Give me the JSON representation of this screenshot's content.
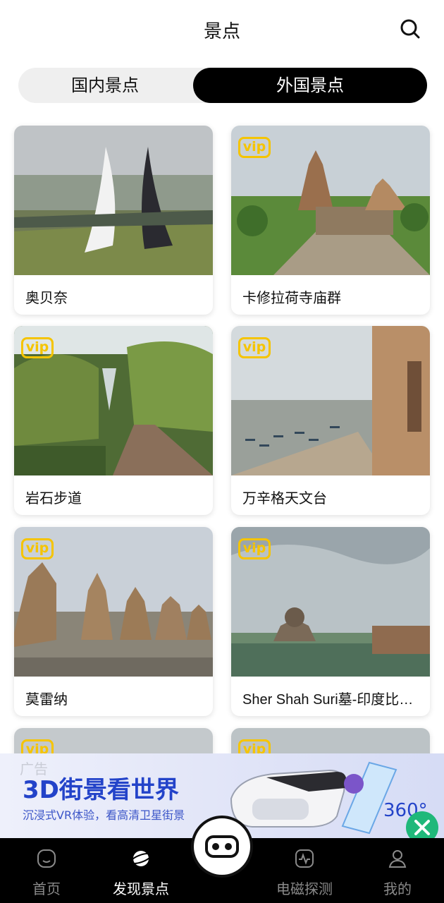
{
  "header": {
    "title": "景点"
  },
  "tabs": [
    {
      "label": "国内景点",
      "active": false
    },
    {
      "label": "外国景点",
      "active": true
    }
  ],
  "badge_text": "vip",
  "spots": [
    {
      "name": "奥贝奈",
      "vip": false
    },
    {
      "name": "卡修拉荷寺庙群",
      "vip": true
    },
    {
      "name": "岩石步道",
      "vip": true
    },
    {
      "name": "万辛格天文台",
      "vip": true
    },
    {
      "name": "莫雷纳",
      "vip": true
    },
    {
      "name": "Sher Shah Suri墓-印度比哈尔邦",
      "vip": true
    }
  ],
  "ad": {
    "tag": "广告",
    "headline": "3D街景看世界",
    "subtitle": "沉浸式VR体验，看高清卫星街景",
    "badge": "360°"
  },
  "bottom_nav": [
    {
      "label": "首页",
      "icon": "home-icon",
      "active": false
    },
    {
      "label": "发现景点",
      "icon": "planet-icon",
      "active": true
    },
    {
      "label": "电磁探测",
      "icon": "pulse-icon",
      "active": false
    },
    {
      "label": "我的",
      "icon": "profile-icon",
      "active": false
    }
  ],
  "colors": {
    "vip": "#f5c400",
    "active_tab_bg": "#000000",
    "ad_text": "#2343c9",
    "ad_close": "#1fb87a"
  }
}
